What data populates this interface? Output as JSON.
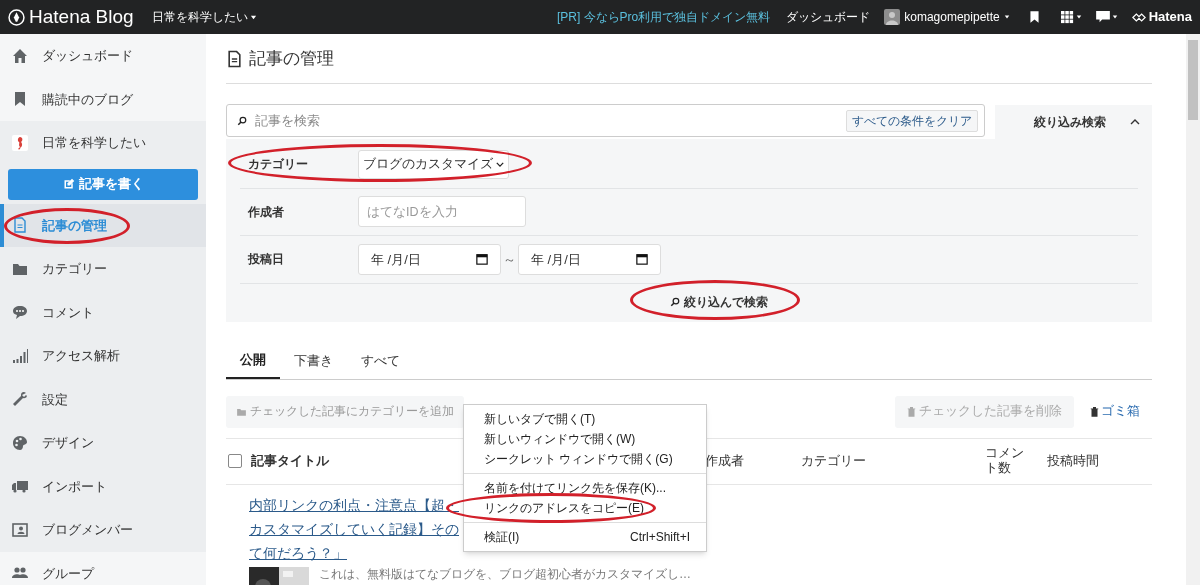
{
  "header": {
    "logo": "Hatena Blog",
    "blog_menu": "日常を科学したい",
    "promo": "[PR] 今ならPro利用で独自ドメイン無料",
    "dashboard": "ダッシュボード",
    "user": "komagomepipette",
    "brand": "Hatena"
  },
  "sidebar": {
    "global_items": [
      {
        "label": "ダッシュボード",
        "selected": false,
        "circled": false
      },
      {
        "label": "購読中のブログ",
        "selected": false,
        "circled": false
      }
    ],
    "blog": {
      "name": "日常を科学したい",
      "write_button": "記事を書く",
      "items": [
        {
          "label": "記事の管理",
          "selected": true,
          "circled": true
        },
        {
          "label": "カテゴリー",
          "selected": false,
          "circled": false
        },
        {
          "label": "コメント",
          "selected": false,
          "circled": false
        },
        {
          "label": "アクセス解析",
          "selected": false,
          "circled": false
        },
        {
          "label": "設定",
          "selected": false,
          "circled": false
        },
        {
          "label": "デザイン",
          "selected": false,
          "circled": false
        },
        {
          "label": "インポート",
          "selected": false,
          "circled": false
        },
        {
          "label": "ブログメンバー",
          "selected": false,
          "circled": false
        }
      ]
    },
    "footer_items": [
      {
        "label": "グループ",
        "selected": false,
        "circled": false
      }
    ]
  },
  "page_title": "記事の管理",
  "search": {
    "placeholder": "記事を検索",
    "clear": "すべての条件をクリア",
    "panel_title": "絞り込み検索",
    "expanded": true
  },
  "filters": [
    {
      "kind": "select",
      "label": "カテゴリー",
      "value": "ブログのカスタマイズ",
      "circled": true
    },
    {
      "kind": "text",
      "label": "作成者",
      "placeholder": "はてなIDを入力",
      "circled": false
    },
    {
      "kind": "dates",
      "label": "投稿日",
      "from": "年 /月/日",
      "separator": "～",
      "to": "年 /月/日",
      "circled": false
    }
  ],
  "filter_button": {
    "label": "絞り込んで検索",
    "circled": true
  },
  "tabs": [
    {
      "label": "公開",
      "selected": true
    },
    {
      "label": "下書き",
      "selected": false
    },
    {
      "label": "すべて",
      "selected": false
    }
  ],
  "actions": {
    "add_category": "チェックした記事にカテゴリーを追加",
    "delete": "チェックした記事を削除",
    "trash": "ゴミ箱"
  },
  "table": {
    "select_all_checked": false,
    "columns": [
      "記事タイトル",
      "作成者",
      "カテゴリー",
      "コメント数",
      "投稿時間"
    ],
    "rows": [
      {
        "title_lines": [
          "内部リンクの利点・注意点【超・",
          "カスタマイズしていく記録】その",
          "て何だろう？」"
        ],
        "excerpt": "これは、無料版はてなブログを、ブログ超初心者がカスタマイズし…"
      }
    ]
  },
  "context_menu": {
    "groups": [
      [
        {
          "label": "新しいタブで開く(T)",
          "circled": false
        },
        {
          "label": "新しいウィンドウで開く(W)",
          "circled": false
        },
        {
          "label": "シークレット ウィンドウで開く(G)",
          "circled": false
        }
      ],
      [
        {
          "label": "名前を付けてリンク先を保存(K)...",
          "circled": false
        },
        {
          "label": "リンクのアドレスをコピー(E)",
          "circled": true
        }
      ],
      [
        {
          "label": "検証(I)",
          "shortcut": "Ctrl+Shift+I",
          "circled": false
        }
      ]
    ]
  }
}
